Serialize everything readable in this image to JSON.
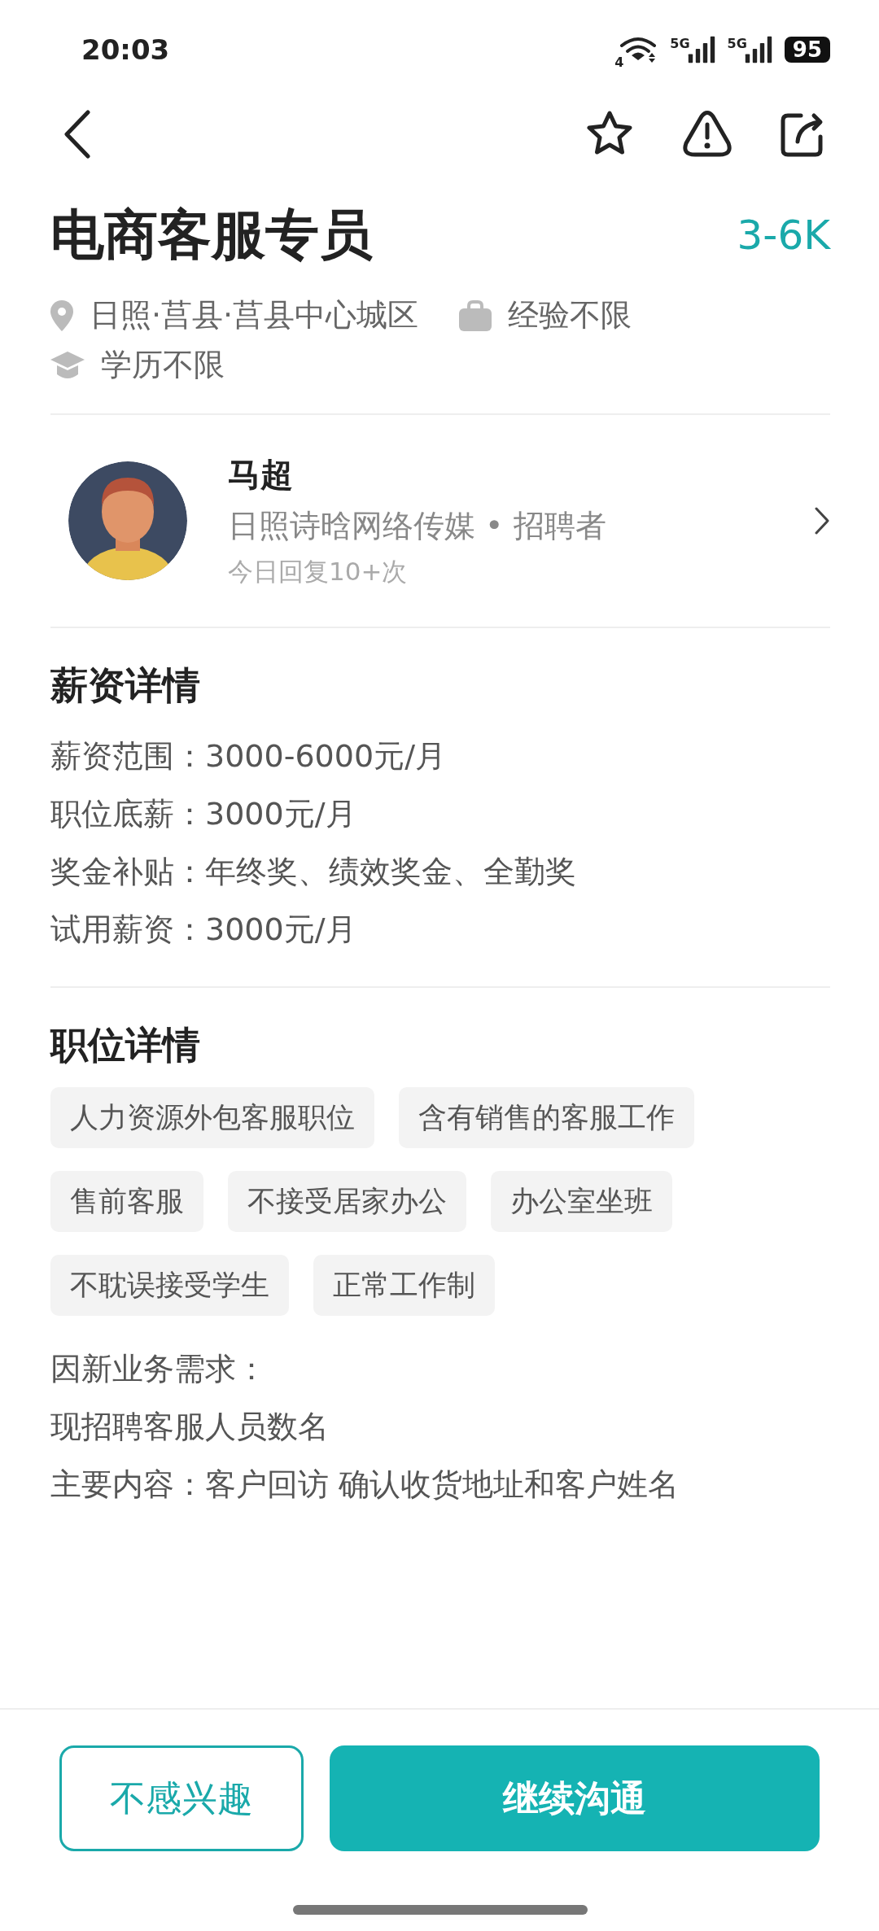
{
  "status_bar": {
    "time": "20:03",
    "network_1": "5G",
    "network_2": "5G",
    "wifi_label": "4",
    "battery": "95"
  },
  "job": {
    "title": "电商客服专员",
    "salary": "3-6K",
    "meta": [
      {
        "kind": "location",
        "text": "日照·莒县·莒县中心城区"
      },
      {
        "kind": "experience",
        "text": "经验不限"
      },
      {
        "kind": "education",
        "text": "学历不限"
      }
    ]
  },
  "recruiter": {
    "name": "马超",
    "company": "日照诗晗网络传媒 • 招聘者",
    "reply_note": "今日回复10+次"
  },
  "salary_section": {
    "title": "薪资详情",
    "lines": [
      "薪资范围：3000-6000元/月",
      "职位底薪：3000元/月",
      "奖金补贴：年终奖、绩效奖金、全勤奖",
      "试用薪资：3000元/月"
    ]
  },
  "job_section": {
    "title": "职位详情",
    "tags": [
      "人力资源外包客服职位",
      "含有销售的客服工作",
      "售前客服",
      "不接受居家办公",
      "办公室坐班",
      "不耽误接受学生",
      "正常工作制"
    ],
    "description": [
      "因新业务需求：",
      "现招聘客服人员数名",
      "主要内容：客户回访 确认收货地址和客户姓名"
    ]
  },
  "buttons": [
    {
      "kind": "secondary",
      "label": "不感兴趣"
    },
    {
      "kind": "primary",
      "label": "继续沟通"
    }
  ]
}
